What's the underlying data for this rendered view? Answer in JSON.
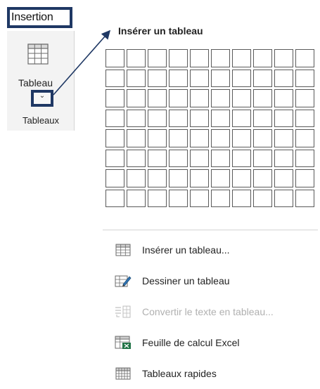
{
  "ribbon": {
    "tab_label": "Insertion",
    "button_label": "Tableau",
    "dropdown_glyph": "⌄",
    "group_label": "Tableaux",
    "highlight_color": "#1f3864"
  },
  "panel": {
    "title": "Insérer un tableau",
    "grid_rows": 8,
    "grid_cols": 10
  },
  "menu": {
    "items": [
      {
        "label": "Insérer un tableau...",
        "icon": "insert-table-icon",
        "enabled": true
      },
      {
        "label": "Dessiner un tableau",
        "icon": "draw-table-icon",
        "enabled": true
      },
      {
        "label": "Convertir le texte en tableau...",
        "icon": "convert-text-to-table-icon",
        "enabled": false
      },
      {
        "label": "Feuille de calcul Excel",
        "icon": "excel-sheet-icon",
        "enabled": true
      },
      {
        "label": "Tableaux rapides",
        "icon": "quick-tables-icon",
        "enabled": true
      }
    ]
  }
}
